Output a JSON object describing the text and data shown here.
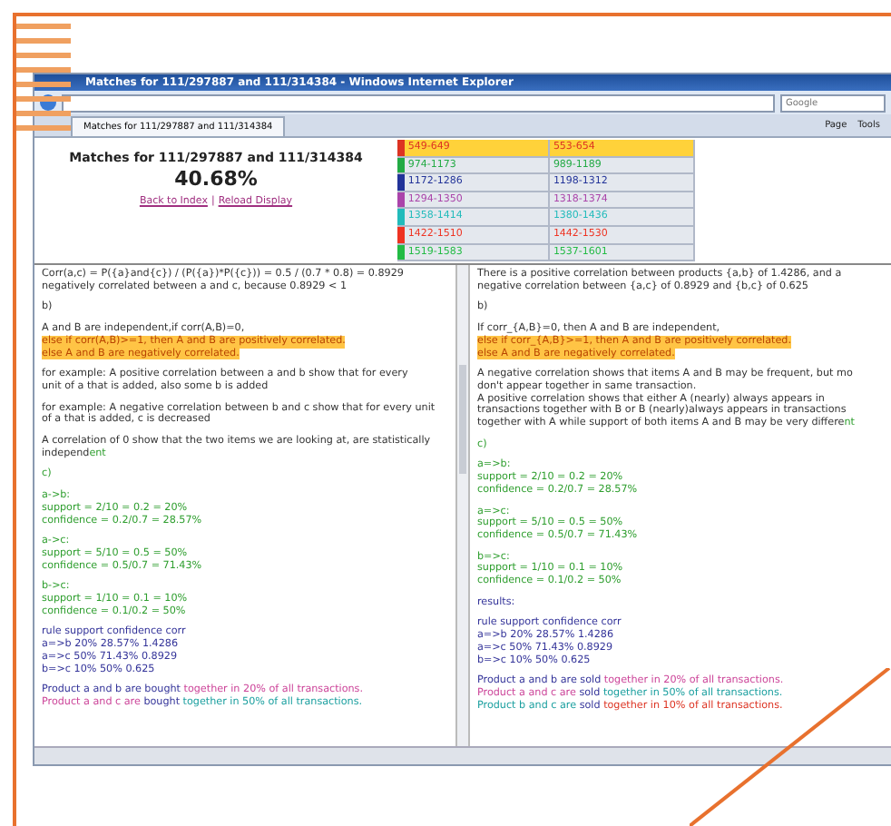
{
  "window": {
    "title": "Matches for 111/297887 and 111/314384 - Windows Internet Explorer"
  },
  "search": {
    "placeholder": "Google"
  },
  "tab": {
    "label": "Matches for 111/297887 and 111/314384"
  },
  "toolbar": [
    "Page",
    "Tools"
  ],
  "header": {
    "title": "Matches for 111/297887 and 111/314384",
    "score": "40.68%",
    "links": [
      "Back to Index",
      "Reload Display"
    ],
    "separator": "|"
  },
  "matches": [
    {
      "color": "#dd3322",
      "left": "549-649",
      "right": "553-654",
      "selected": true
    },
    {
      "color": "#22aa44",
      "left": "974-1173",
      "right": "989-1189",
      "selected": false
    },
    {
      "color": "#223399",
      "left": "1172-1286",
      "right": "1198-1312",
      "selected": false
    },
    {
      "color": "#aa44aa",
      "left": "1294-1350",
      "right": "1318-1374",
      "selected": false
    },
    {
      "color": "#22bbbb",
      "left": "1358-1414",
      "right": "1380-1436",
      "selected": false
    },
    {
      "color": "#ee3322",
      "left": "1422-1510",
      "right": "1442-1530",
      "selected": false
    },
    {
      "color": "#22bb44",
      "left": "1519-1583",
      "right": "1537-1601",
      "selected": false
    }
  ],
  "left_panel": {
    "paragraphs": [
      {
        "lines": [
          {
            "highlight": false,
            "segments": [
              {
                "text": "Corr(a,c) = P({a}and{c}) / (P({a})*P({c})) = 0.5 / (0.7 * 0.8) = 0.8929",
                "kind": "text"
              }
            ]
          },
          {
            "highlight": false,
            "segments": [
              {
                "text": "negatively correlated between a and c, because 0.8929 < 1",
                "kind": "text"
              }
            ]
          }
        ]
      },
      {
        "lines": [
          {
            "highlight": false,
            "segments": [
              {
                "text": "b)",
                "kind": "text"
              }
            ]
          }
        ]
      },
      {
        "lines": [
          {
            "highlight": false,
            "segments": [
              {
                "text": "A and B are independent,if corr(A,B)=0,",
                "kind": "text"
              }
            ]
          },
          {
            "highlight": true,
            "segments": [
              {
                "text": "else if corr(A,B)>=1, then A and B are positively correlated.",
                "kind": "emphasis"
              }
            ]
          },
          {
            "highlight": true,
            "segments": [
              {
                "text": "else A and B are negatively correlated.",
                "kind": "emphasis"
              }
            ]
          }
        ]
      },
      {
        "lines": [
          {
            "highlight": false,
            "segments": [
              {
                "text": "for example: A positive correlation between a and b show that for every",
                "kind": "text"
              }
            ]
          },
          {
            "highlight": false,
            "segments": [
              {
                "text": "unit of a that is added, also some b is added",
                "kind": "text"
              }
            ]
          }
        ]
      },
      {
        "lines": [
          {
            "highlight": false,
            "segments": [
              {
                "text": "for example: A negative correlation between b and c show that for every unit",
                "kind": "text"
              }
            ]
          },
          {
            "highlight": false,
            "segments": [
              {
                "text": "of a that is added, c is decreased",
                "kind": "text"
              }
            ]
          }
        ]
      },
      {
        "lines": [
          {
            "highlight": false,
            "segments": [
              {
                "text": "A correlation of 0 show that the two items we are looking at, are statistically",
                "kind": "text"
              }
            ]
          },
          {
            "highlight": false,
            "segments": [
              {
                "text": "independ",
                "kind": "text"
              },
              {
                "text": "ent",
                "kind": "calc"
              }
            ]
          }
        ]
      },
      {
        "lines": [
          {
            "highlight": false,
            "segments": [
              {
                "text": "c)",
                "kind": "calc"
              }
            ]
          }
        ]
      },
      {
        "lines": [
          {
            "highlight": false,
            "segments": [
              {
                "text": "a->b:",
                "kind": "calc"
              }
            ]
          },
          {
            "highlight": false,
            "segments": [
              {
                "text": "support = 2/10 = 0.2 = 20%",
                "kind": "calc"
              }
            ]
          },
          {
            "highlight": false,
            "segments": [
              {
                "text": "confidence = 0.2/0.7 = 28.57%",
                "kind": "calc"
              }
            ]
          }
        ]
      },
      {
        "lines": [
          {
            "highlight": false,
            "segments": [
              {
                "text": "a->c:",
                "kind": "calc"
              }
            ]
          },
          {
            "highlight": false,
            "segments": [
              {
                "text": "support = 5/10 = 0.5 = 50%",
                "kind": "calc"
              }
            ]
          },
          {
            "highlight": false,
            "segments": [
              {
                "text": "confidence = 0.5/0.7 = 71.43%",
                "kind": "calc"
              }
            ]
          }
        ]
      },
      {
        "lines": [
          {
            "highlight": false,
            "segments": [
              {
                "text": "b->c:",
                "kind": "calc"
              }
            ]
          },
          {
            "highlight": false,
            "segments": [
              {
                "text": "support = 1/10 = 0.1 = 10%",
                "kind": "calc"
              }
            ]
          },
          {
            "highlight": false,
            "segments": [
              {
                "text": "confidence = 0.1/0.2 = 50%",
                "kind": "calc"
              }
            ]
          }
        ]
      },
      {
        "lines": [
          {
            "highlight": false,
            "segments": [
              {
                "text": "rule support confidence corr",
                "kind": "table"
              }
            ]
          },
          {
            "highlight": false,
            "segments": [
              {
                "text": "a=>b 20% 28.57% 1.4286",
                "kind": "table"
              }
            ]
          },
          {
            "highlight": false,
            "segments": [
              {
                "text": "a=>c 50% 71.43% 0.8929",
                "kind": "table"
              }
            ]
          },
          {
            "highlight": false,
            "segments": [
              {
                "text": "b=>c 10% 50% 0.625",
                "kind": "table"
              }
            ]
          }
        ]
      },
      {
        "lines": [
          {
            "highlight": false,
            "segments": [
              {
                "text": "Product a and b are bought ",
                "kind": "table"
              },
              {
                "text": "together in 20% of all transactions.",
                "kind": "pink"
              }
            ]
          },
          {
            "highlight": false,
            "segments": [
              {
                "text": "Product a and c are ",
                "kind": "pink"
              },
              {
                "text": "bought ",
                "kind": "table"
              },
              {
                "text": "together in 50% of all transactions.",
                "kind": "teal"
              }
            ]
          }
        ]
      }
    ]
  },
  "right_panel": {
    "paragraphs": [
      {
        "lines": [
          {
            "highlight": false,
            "segments": [
              {
                "text": "There is a positive correlation between products {a,b} of 1.4286, and a",
                "kind": "text"
              }
            ]
          },
          {
            "highlight": false,
            "segments": [
              {
                "text": "negative correlation between {a,c} of 0.8929 and {b,c} of 0.625",
                "kind": "text"
              }
            ]
          }
        ]
      },
      {
        "lines": [
          {
            "highlight": false,
            "segments": [
              {
                "text": "b)",
                "kind": "text"
              }
            ]
          }
        ]
      },
      {
        "lines": [
          {
            "highlight": false,
            "segments": [
              {
                "text": "If corr_{A,B}=0, then A and B are independent,",
                "kind": "text"
              }
            ]
          },
          {
            "highlight": true,
            "segments": [
              {
                "text": "else if corr_{A,B}>=1, then A and B are positively correlated.",
                "kind": "emphasis"
              }
            ]
          },
          {
            "highlight": true,
            "segments": [
              {
                "text": "else A and B are negatively correlated.",
                "kind": "emphasis"
              }
            ]
          }
        ]
      },
      {
        "lines": [
          {
            "highlight": false,
            "segments": [
              {
                "text": "A negative correlation shows that items A and B may be frequent, but mo",
                "kind": "text"
              }
            ]
          },
          {
            "highlight": false,
            "segments": [
              {
                "text": "don't appear together in same transaction.",
                "kind": "text"
              }
            ]
          },
          {
            "highlight": false,
            "segments": [
              {
                "text": "A positive correlation shows that either A (nearly) always appears in",
                "kind": "text"
              }
            ]
          },
          {
            "highlight": false,
            "segments": [
              {
                "text": "transactions together with B or B (nearly)always appears in transactions",
                "kind": "text"
              }
            ]
          },
          {
            "highlight": false,
            "segments": [
              {
                "text": "together with A while support of both items A and B may be very differe",
                "kind": "text"
              },
              {
                "text": "nt",
                "kind": "calc"
              }
            ]
          }
        ]
      },
      {
        "lines": [
          {
            "highlight": false,
            "segments": [
              {
                "text": "c)",
                "kind": "calc"
              }
            ]
          }
        ]
      },
      {
        "lines": [
          {
            "highlight": false,
            "segments": [
              {
                "text": "a=>b:",
                "kind": "calc"
              }
            ]
          },
          {
            "highlight": false,
            "segments": [
              {
                "text": "support = 2/10 = 0.2 = 20%",
                "kind": "calc"
              }
            ]
          },
          {
            "highlight": false,
            "segments": [
              {
                "text": "confidence = 0.2/0.7 = 28.57%",
                "kind": "calc"
              }
            ]
          }
        ]
      },
      {
        "lines": [
          {
            "highlight": false,
            "segments": [
              {
                "text": "a=>c:",
                "kind": "calc"
              }
            ]
          },
          {
            "highlight": false,
            "segments": [
              {
                "text": "support = 5/10 = 0.5 = 50%",
                "kind": "calc"
              }
            ]
          },
          {
            "highlight": false,
            "segments": [
              {
                "text": "confidence = 0.5/0.7 = 71.43%",
                "kind": "calc"
              }
            ]
          }
        ]
      },
      {
        "lines": [
          {
            "highlight": false,
            "segments": [
              {
                "text": "b=>c:",
                "kind": "calc"
              }
            ]
          },
          {
            "highlight": false,
            "segments": [
              {
                "text": "support = 1/10 = 0.1 = 10%",
                "kind": "calc"
              }
            ]
          },
          {
            "highlight": false,
            "segments": [
              {
                "text": "confidence = 0.1/0.2 = 50%",
                "kind": "calc"
              }
            ]
          }
        ]
      },
      {
        "lines": [
          {
            "highlight": false,
            "segments": [
              {
                "text": "results:",
                "kind": "table"
              }
            ]
          }
        ]
      },
      {
        "lines": [
          {
            "highlight": false,
            "segments": [
              {
                "text": "rule support confidence corr",
                "kind": "table"
              }
            ]
          },
          {
            "highlight": false,
            "segments": [
              {
                "text": "a=>b 20% 28.57% 1.4286",
                "kind": "table"
              }
            ]
          },
          {
            "highlight": false,
            "segments": [
              {
                "text": "a=>c 50% 71.43% 0.8929",
                "kind": "table"
              }
            ]
          },
          {
            "highlight": false,
            "segments": [
              {
                "text": "b=>c 10% 50% 0.625",
                "kind": "table"
              }
            ]
          }
        ]
      },
      {
        "lines": [
          {
            "highlight": false,
            "segments": [
              {
                "text": "Product a and b are sold ",
                "kind": "table"
              },
              {
                "text": "together in 20% of all transactions.",
                "kind": "pink"
              }
            ]
          },
          {
            "highlight": false,
            "segments": [
              {
                "text": "Product a and c are ",
                "kind": "pink"
              },
              {
                "text": "sold ",
                "kind": "table"
              },
              {
                "text": "together in 50% of all transactions.",
                "kind": "teal"
              }
            ]
          },
          {
            "highlight": false,
            "segments": [
              {
                "text": "Product b and c are ",
                "kind": "teal"
              },
              {
                "text": "sold ",
                "kind": "table"
              },
              {
                "text": "together in 10% of all transactions.",
                "kind": "red"
              }
            ]
          }
        ]
      }
    ]
  }
}
